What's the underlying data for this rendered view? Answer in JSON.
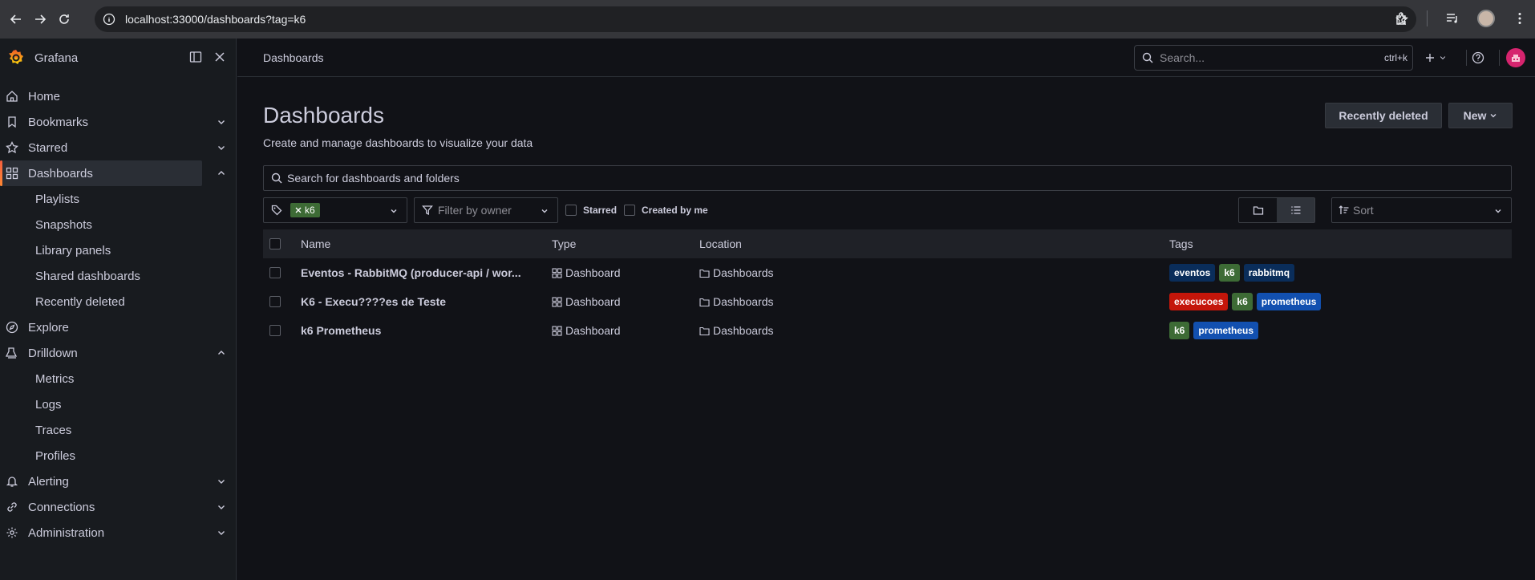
{
  "browser": {
    "url": "localhost:33000/dashboards?tag=k6"
  },
  "app": {
    "name": "Grafana"
  },
  "sidebar": {
    "items": [
      {
        "label": "Home",
        "icon": "home-icon"
      },
      {
        "label": "Bookmarks",
        "icon": "bookmark-icon",
        "expandable": true
      },
      {
        "label": "Starred",
        "icon": "star-icon",
        "expandable": true
      },
      {
        "label": "Dashboards",
        "icon": "apps-icon",
        "expandable": true,
        "active": true
      },
      {
        "label": "Playlists",
        "sub": true
      },
      {
        "label": "Snapshots",
        "sub": true
      },
      {
        "label": "Library panels",
        "sub": true
      },
      {
        "label": "Shared dashboards",
        "sub": true
      },
      {
        "label": "Recently deleted",
        "sub": true
      },
      {
        "label": "Explore",
        "icon": "compass-icon"
      },
      {
        "label": "Drilldown",
        "icon": "drilldown-icon",
        "expandable": true
      },
      {
        "label": "Metrics",
        "sub": true
      },
      {
        "label": "Logs",
        "sub": true
      },
      {
        "label": "Traces",
        "sub": true
      },
      {
        "label": "Profiles",
        "sub": true
      },
      {
        "label": "Alerting",
        "icon": "bell-icon",
        "expandable": true
      },
      {
        "label": "Connections",
        "icon": "link-icon",
        "expandable": true
      },
      {
        "label": "Administration",
        "icon": "gear-icon",
        "expandable": true
      }
    ]
  },
  "topbar": {
    "breadcrumb": "Dashboards",
    "search_placeholder": "Search...",
    "search_shortcut": "ctrl+k"
  },
  "page": {
    "title": "Dashboards",
    "subtitle": "Create and manage dashboards to visualize your data",
    "recently_deleted_label": "Recently deleted",
    "new_label": "New",
    "search_placeholder": "Search for dashboards and folders",
    "tag_filter": "k6",
    "owner_placeholder": "Filter by owner",
    "starred_label": "Starred",
    "created_label": "Created by me",
    "sort_placeholder": "Sort"
  },
  "table": {
    "headers": {
      "name": "Name",
      "type": "Type",
      "location": "Location",
      "tags": "Tags"
    },
    "rows": [
      {
        "name": "Eventos - RabbitMQ (producer-api / wor...",
        "type": "Dashboard",
        "location": "Dashboards",
        "tags": [
          {
            "label": "eventos",
            "color": "#0a2d5a"
          },
          {
            "label": "k6",
            "color": "#3d6b35"
          },
          {
            "label": "rabbitmq",
            "color": "#0a2d5a"
          }
        ]
      },
      {
        "name": "K6 - Execu????es de Teste",
        "type": "Dashboard",
        "location": "Dashboards",
        "tags": [
          {
            "label": "execucoes",
            "color": "#c4160a"
          },
          {
            "label": "k6",
            "color": "#3d6b35"
          },
          {
            "label": "prometheus",
            "color": "#1250b0"
          }
        ]
      },
      {
        "name": "k6 Prometheus",
        "type": "Dashboard",
        "location": "Dashboards",
        "tags": [
          {
            "label": "k6",
            "color": "#3d6b35"
          },
          {
            "label": "prometheus",
            "color": "#1250b0"
          }
        ]
      }
    ]
  }
}
